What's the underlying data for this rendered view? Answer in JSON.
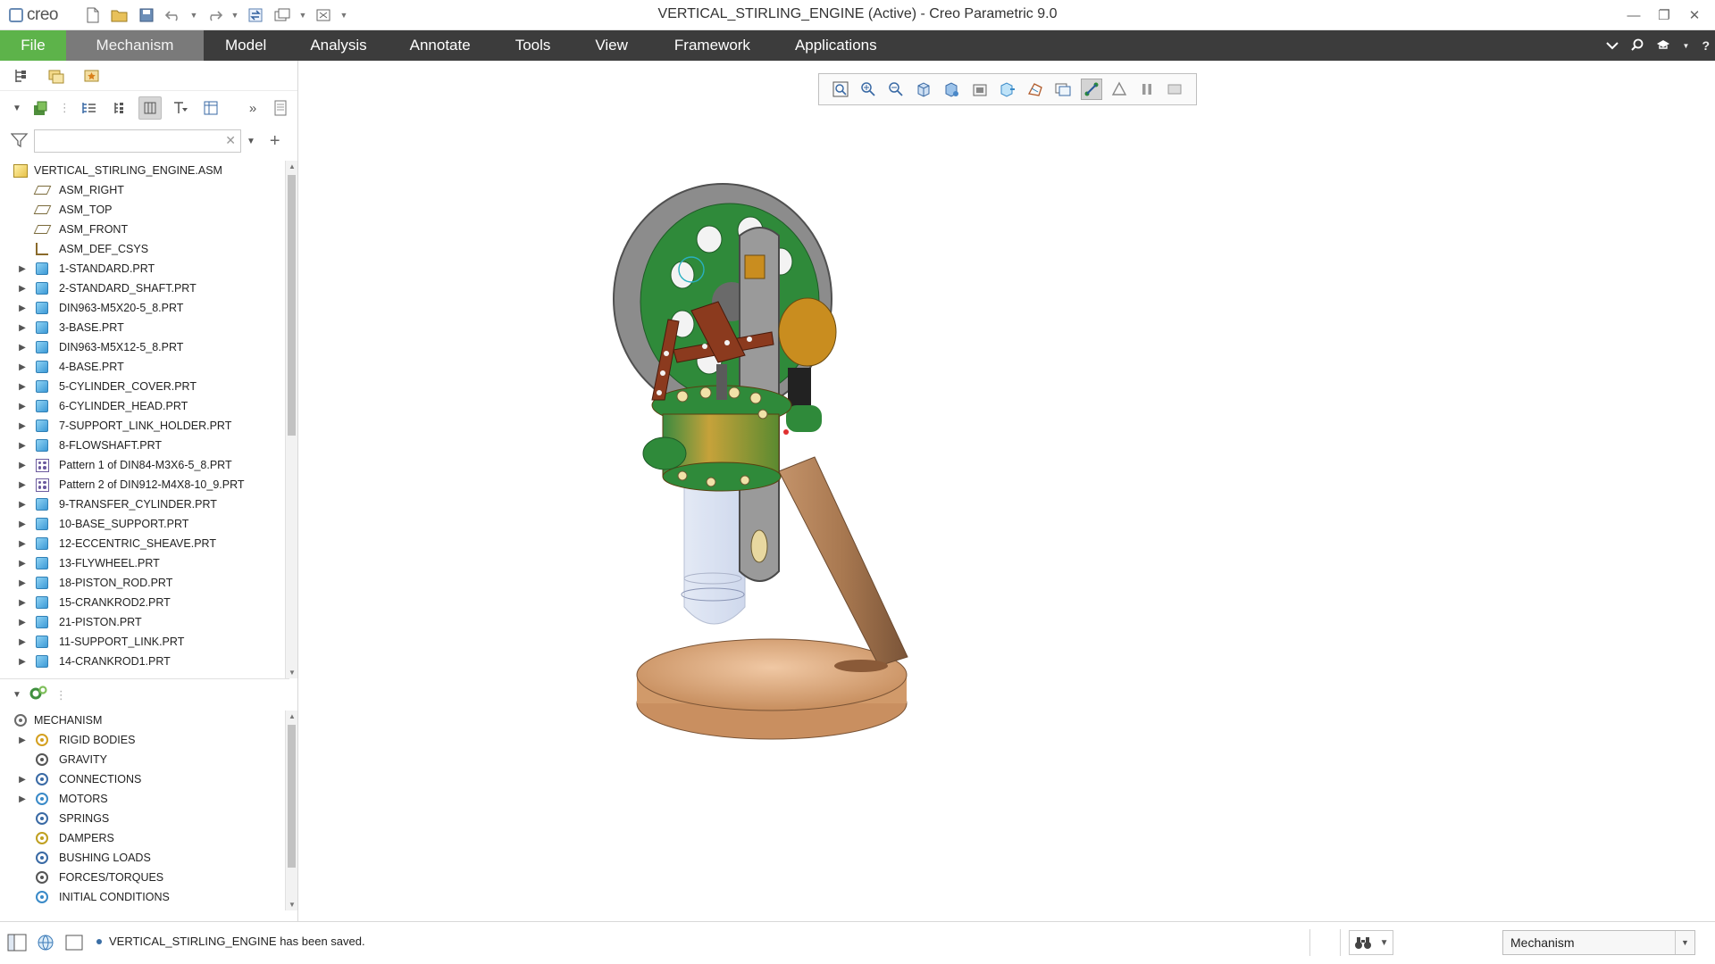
{
  "app": {
    "logo_text": "creo",
    "window_title": "VERTICAL_STIRLING_ENGINE (Active) - Creo Parametric 9.0"
  },
  "ribbon": {
    "tabs": [
      {
        "label": "File"
      },
      {
        "label": "Mechanism"
      },
      {
        "label": "Model"
      },
      {
        "label": "Analysis"
      },
      {
        "label": "Annotate"
      },
      {
        "label": "Tools"
      },
      {
        "label": "View"
      },
      {
        "label": "Framework"
      },
      {
        "label": "Applications"
      }
    ],
    "active_tab": "Mechanism"
  },
  "model_tree": {
    "search_placeholder": "",
    "items": [
      {
        "label": "VERTICAL_STIRLING_ENGINE.ASM",
        "icon": "assembly-icon"
      },
      {
        "label": "ASM_RIGHT",
        "icon": "datum-plane-icon"
      },
      {
        "label": "ASM_TOP",
        "icon": "datum-plane-icon"
      },
      {
        "label": "ASM_FRONT",
        "icon": "datum-plane-icon"
      },
      {
        "label": "ASM_DEF_CSYS",
        "icon": "csys-icon"
      },
      {
        "label": "1-STANDARD.PRT",
        "icon": "part-icon"
      },
      {
        "label": "2-STANDARD_SHAFT.PRT",
        "icon": "part-icon"
      },
      {
        "label": "DIN963-M5X20-5_8.PRT",
        "icon": "part-icon"
      },
      {
        "label": "3-BASE.PRT",
        "icon": "part-icon"
      },
      {
        "label": "DIN963-M5X12-5_8.PRT",
        "icon": "part-icon"
      },
      {
        "label": "4-BASE.PRT",
        "icon": "part-icon"
      },
      {
        "label": "5-CYLINDER_COVER.PRT",
        "icon": "part-icon"
      },
      {
        "label": "6-CYLINDER_HEAD.PRT",
        "icon": "part-icon"
      },
      {
        "label": "7-SUPPORT_LINK_HOLDER.PRT",
        "icon": "part-icon"
      },
      {
        "label": "8-FLOWSHAFT.PRT",
        "icon": "part-icon"
      },
      {
        "label": "Pattern 1 of DIN84-M3X6-5_8.PRT",
        "icon": "pattern-icon"
      },
      {
        "label": "Pattern 2 of DIN912-M4X8-10_9.PRT",
        "icon": "pattern-icon"
      },
      {
        "label": "9-TRANSFER_CYLINDER.PRT",
        "icon": "part-icon"
      },
      {
        "label": "10-BASE_SUPPORT.PRT",
        "icon": "part-icon"
      },
      {
        "label": "12-ECCENTRIC_SHEAVE.PRT",
        "icon": "part-icon"
      },
      {
        "label": "13-FLYWHEEL.PRT",
        "icon": "part-icon"
      },
      {
        "label": "18-PISTON_ROD.PRT",
        "icon": "part-icon"
      },
      {
        "label": "15-CRANKROD2.PRT",
        "icon": "part-icon"
      },
      {
        "label": "21-PISTON.PRT",
        "icon": "part-icon"
      },
      {
        "label": "11-SUPPORT_LINK.PRT",
        "icon": "part-icon"
      },
      {
        "label": "14-CRANKROD1.PRT",
        "icon": "part-icon"
      }
    ]
  },
  "mechanism_tree": {
    "items": [
      {
        "label": "MECHANISM",
        "icon": "mechanism-icon"
      },
      {
        "label": "RIGID BODIES",
        "icon": "rigid-bodies-icon"
      },
      {
        "label": "GRAVITY",
        "icon": "gravity-icon"
      },
      {
        "label": "CONNECTIONS",
        "icon": "connections-icon"
      },
      {
        "label": "MOTORS",
        "icon": "motors-icon"
      },
      {
        "label": "SPRINGS",
        "icon": "springs-icon"
      },
      {
        "label": "DAMPERS",
        "icon": "dampers-icon"
      },
      {
        "label": "BUSHING LOADS",
        "icon": "bushing-loads-icon"
      },
      {
        "label": "FORCES/TORQUES",
        "icon": "forces-torques-icon"
      },
      {
        "label": "INITIAL CONDITIONS",
        "icon": "initial-conditions-icon"
      }
    ]
  },
  "status": {
    "message": "VERTICAL_STIRLING_ENGINE has been saved.",
    "mode_value": "Mechanism"
  },
  "colors": {
    "file_tab": "#5db34a",
    "ribbon_bg": "#3c3c3c",
    "active_tab": "#7a7a7a",
    "flywheel": "#8a8a8a",
    "engine_green": "#2f8a3a",
    "crank_rust": "#8b3a1e",
    "base_wood": "#d9a87c",
    "brass": "#c98d1f"
  }
}
